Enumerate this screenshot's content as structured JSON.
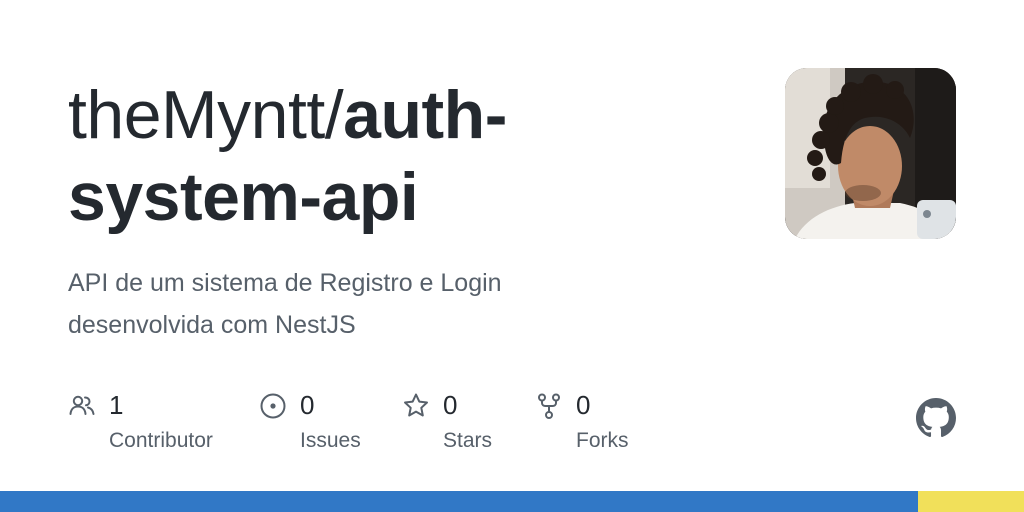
{
  "repo": {
    "owner": "theMyntt/",
    "name": "auth-system-api",
    "description": "API de um sistema de Registro e Login desenvolvida com NestJS"
  },
  "stats": [
    {
      "count": "1",
      "label": "Contributor",
      "icon": "people-icon"
    },
    {
      "count": "0",
      "label": "Issues",
      "icon": "issue-opened-icon"
    },
    {
      "count": "0",
      "label": "Stars",
      "icon": "star-icon"
    },
    {
      "count": "0",
      "label": "Forks",
      "icon": "repo-forked-icon"
    }
  ],
  "languages": [
    {
      "color": "#3178c6",
      "share": 0.896
    },
    {
      "color": "#f1e05a",
      "share": 0.104
    }
  ],
  "colors": {
    "text_primary": "#24292f",
    "text_secondary": "#57606a",
    "logo": "#57606a"
  }
}
